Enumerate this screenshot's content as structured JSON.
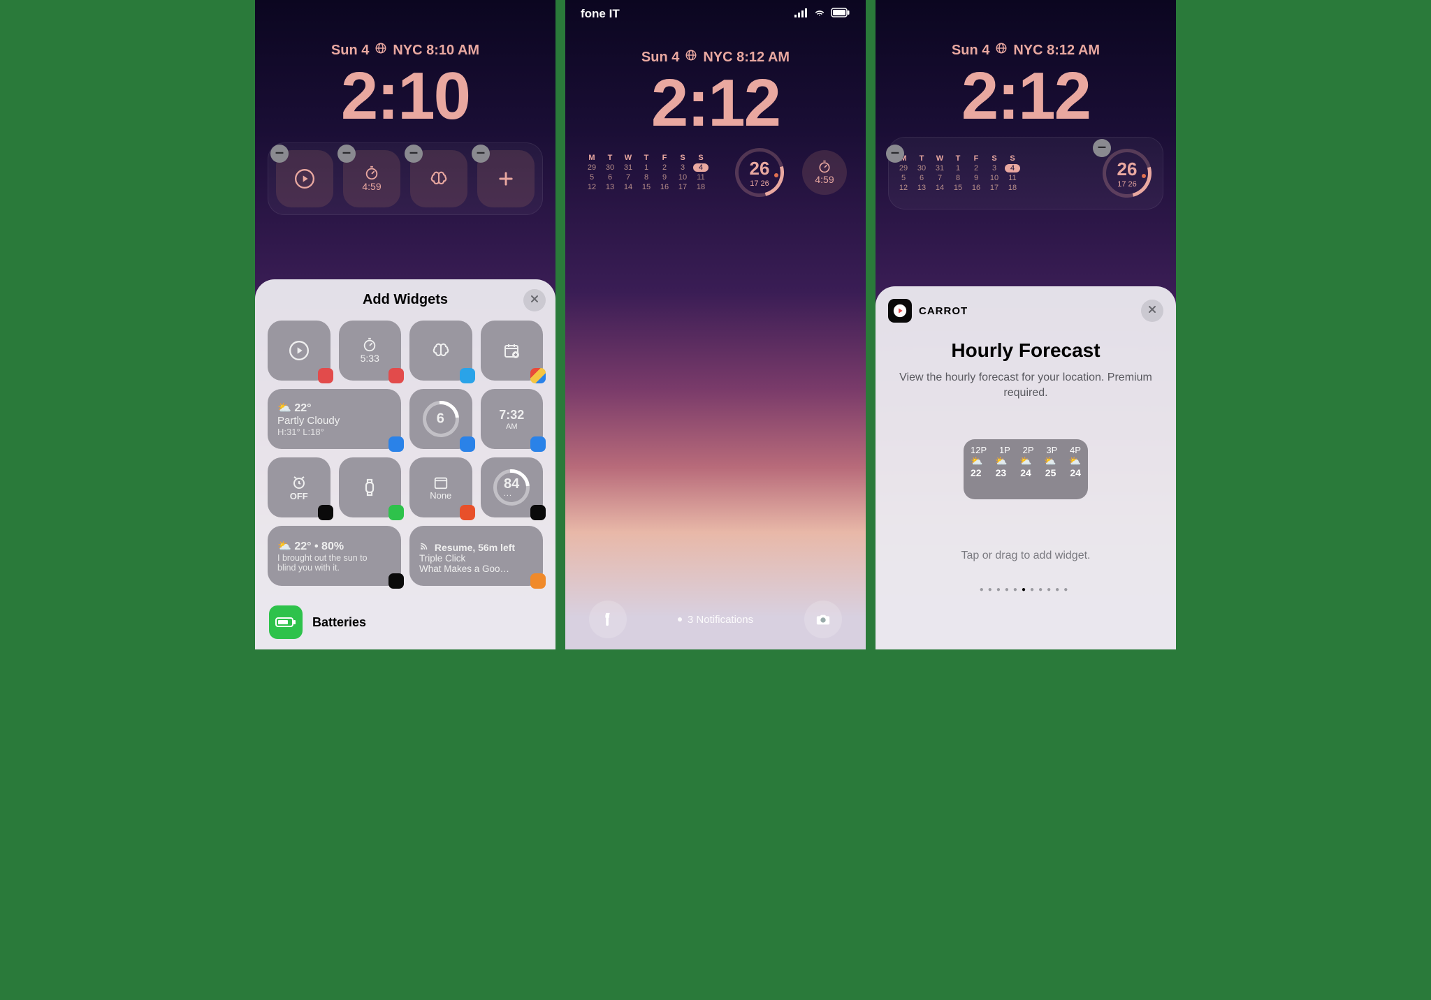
{
  "accent": "#e9a8a0",
  "panel1": {
    "date_day": "Sun 4",
    "date_city": "NYC 8:10 AM",
    "clock": "2:10",
    "slots": [
      {
        "icon": "play",
        "label": ""
      },
      {
        "icon": "hourglass",
        "label": "4:59"
      },
      {
        "icon": "brain",
        "label": ""
      },
      {
        "icon": "plus",
        "label": ""
      }
    ],
    "sheet_title": "Add Widgets",
    "gallery": [
      {
        "type": "sm",
        "icon": "play",
        "label": "",
        "badge": "#e24b4b"
      },
      {
        "type": "sm",
        "icon": "hourglass",
        "label": "5:33",
        "badge": "#e24b4b"
      },
      {
        "type": "sm",
        "icon": "brain",
        "label": "",
        "badge": "#2aa3e8"
      },
      {
        "type": "sm",
        "icon": "calendar-plus",
        "label": "",
        "badge": "#f5c542",
        "badge_multi": true
      },
      {
        "type": "wd",
        "temp": "22°",
        "icon": "pc",
        "cond": "Partly Cloudy",
        "hl": "H:31° L:18°",
        "badge": "#2a82e8"
      },
      {
        "type": "ring",
        "value": "6",
        "badge": "#2a82e8"
      },
      {
        "type": "sm",
        "icon": "clock",
        "label": "7:32",
        "sublabel": "AM",
        "badge": "#2a82e8"
      },
      {
        "type": "sm",
        "icon": "alarm",
        "label": "OFF",
        "badge": "#0a0a0a"
      },
      {
        "type": "sm",
        "icon": "watch",
        "label": "",
        "badge": "#2ec24b"
      },
      {
        "type": "sm",
        "icon": "calendar",
        "label": "None",
        "badge": "#e8502a"
      },
      {
        "type": "ring",
        "value": "84",
        "badge": "#0a0a0a",
        "sub": "dots"
      },
      {
        "type": "wd2",
        "temp": "22° • 80%",
        "text1": "I brought out the sun to",
        "text2": "blind you with it.",
        "badge": "#0a0a0a"
      },
      {
        "type": "wd3",
        "line1": "Resume, 56m left",
        "line2": "Triple Click",
        "line3": "What Makes a Goo…",
        "badge": "#f08a2a"
      }
    ],
    "app_row": {
      "name": "Batteries",
      "color": "#2ec24b"
    }
  },
  "panel2": {
    "carrier": "fone IT",
    "date_day": "Sun 4",
    "date_city": "NYC 8:12 AM",
    "clock": "2:12",
    "cal_headers": [
      "M",
      "T",
      "W",
      "T",
      "F",
      "S",
      "S"
    ],
    "cal_rows": [
      [
        "29",
        "30",
        "31",
        "1",
        "2",
        "3",
        "4"
      ],
      [
        "5",
        "6",
        "7",
        "8",
        "9",
        "10",
        "11"
      ],
      [
        "12",
        "13",
        "14",
        "15",
        "16",
        "17",
        "18"
      ]
    ],
    "cal_today": "4",
    "ring": {
      "big": "26",
      "sub": "17  26"
    },
    "timer": "4:59",
    "notif_count": "3 Notifications"
  },
  "panel3": {
    "date_day": "Sun 4",
    "date_city": "NYC 8:12 AM",
    "clock": "2:12",
    "cal_headers": [
      "M",
      "T",
      "W",
      "T",
      "F",
      "S",
      "S"
    ],
    "cal_rows": [
      [
        "29",
        "30",
        "31",
        "1",
        "2",
        "3",
        "4"
      ],
      [
        "5",
        "6",
        "7",
        "8",
        "9",
        "10",
        "11"
      ],
      [
        "12",
        "13",
        "14",
        "15",
        "16",
        "17",
        "18"
      ]
    ],
    "cal_today": "4",
    "ring": {
      "big": "26",
      "sub": "17  26"
    },
    "sheet": {
      "app": "CARROT",
      "title": "Hourly Forecast",
      "desc": "View the hourly forecast for your location. Premium required.",
      "hint": "Tap or drag to add widget.",
      "preview": {
        "hours": [
          "12P",
          "1P",
          "2P",
          "3P",
          "4P"
        ],
        "temps": [
          "22",
          "23",
          "24",
          "25",
          "24"
        ]
      },
      "page_count": 11,
      "page_active_index": 5
    }
  }
}
